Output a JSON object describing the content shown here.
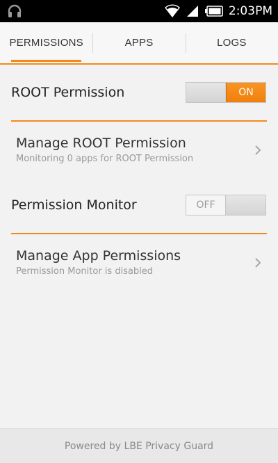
{
  "status_bar": {
    "time": "2:03PM",
    "icons": [
      "headphones-icon",
      "wifi-icon",
      "signal-icon",
      "battery-icon"
    ]
  },
  "tabs": [
    {
      "label": "PERMISSIONS",
      "active": true
    },
    {
      "label": "APPS",
      "active": false
    },
    {
      "label": "LOGS",
      "active": false
    }
  ],
  "root_permission": {
    "label": "ROOT Permission",
    "toggle_on_label": "ON",
    "state": "on"
  },
  "manage_root": {
    "title": "Manage ROOT Permission",
    "subtitle": "Monitoring 0 apps for ROOT Permission"
  },
  "permission_monitor": {
    "label": "Permission Monitor",
    "toggle_off_label": "OFF",
    "state": "off"
  },
  "manage_app": {
    "title": "Manage App Permissions",
    "subtitle": "Permission Monitor is disabled"
  },
  "footer": {
    "text": "Powered by LBE Privacy Guard"
  },
  "colors": {
    "accent": "#f38a1d",
    "status_bar_bg": "#000000",
    "background": "#f2f2f2"
  }
}
